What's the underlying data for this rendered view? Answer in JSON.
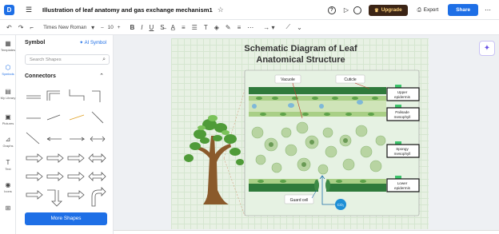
{
  "header": {
    "title": "Illustration of leaf anatomy and gas exchange mechanism1",
    "upgrade_label": "Upgrade",
    "export_label": "Export",
    "share_label": "Share"
  },
  "toolbar": {
    "font_name": "Times New Roman",
    "font_size": "10"
  },
  "rail": {
    "items": [
      "Templates",
      "Symbols",
      "My Library",
      "Pictures",
      "Graphs",
      "Text",
      "Icons"
    ]
  },
  "panel": {
    "title": "Symbol",
    "ai_symbol": "AI Symbol",
    "search_placeholder": "Search Shapes",
    "section": "Connectors",
    "more_shapes": "More Shapes"
  },
  "diagram": {
    "title_line1": "Schematic Diagram of Leaf",
    "title_line2": "Anatomical Structure",
    "labels": {
      "vacuole": "Vacuole",
      "cuticle": "Cuticle",
      "upper_epidermis_1": "Upper",
      "upper_epidermis_2": "epidermis",
      "palisade_1": "Palisade",
      "palisade_2": "mesophyll",
      "spongy_1": "Spongy",
      "spongy_2": "mesophyll",
      "lower_1": "Lower",
      "lower_2": "epidermis",
      "guard_cell": "Guard cell",
      "co2": "CO₂"
    }
  },
  "colors": {
    "accent": "#1e6fe6",
    "upgrade_bg": "#3b2415",
    "leaf_green": "#2f7a3b"
  }
}
